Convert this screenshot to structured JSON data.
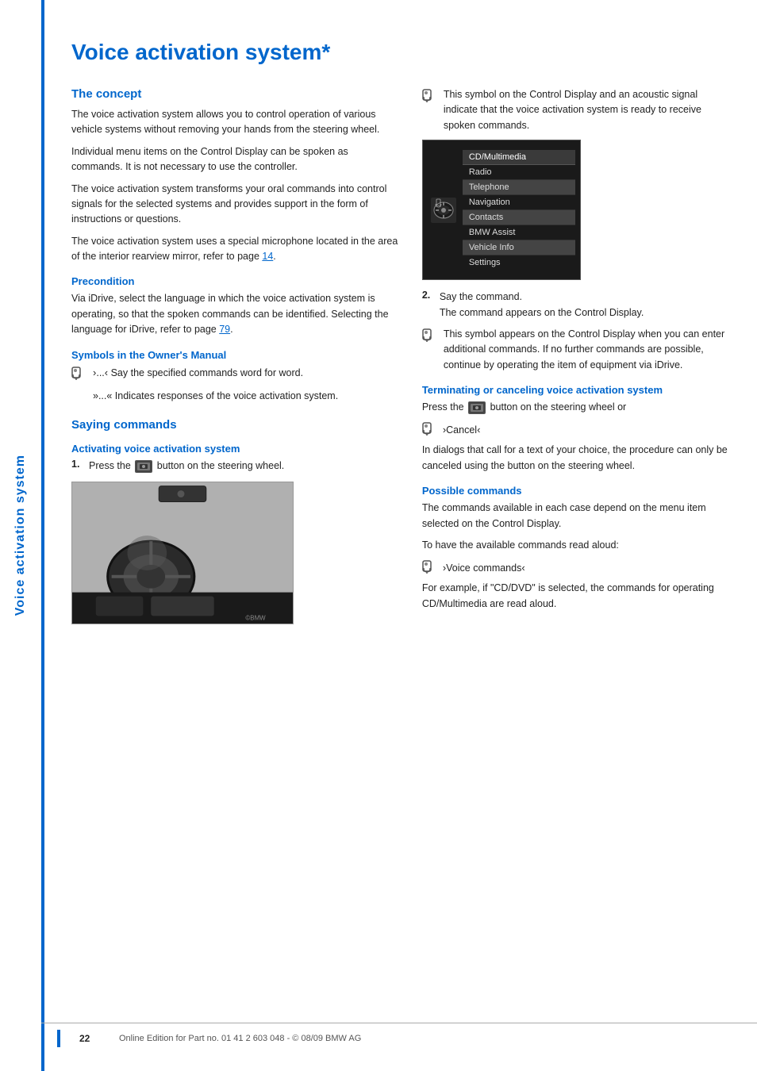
{
  "sidebar": {
    "label": "Voice activation system"
  },
  "page": {
    "title": "Voice activation system*",
    "sections": {
      "concept": {
        "heading": "The concept",
        "paragraphs": [
          "The voice activation system allows you to control operation of various vehicle systems without removing your hands from the steering wheel.",
          "Individual menu items on the Control Display can be spoken as commands. It is not necessary to use the controller.",
          "The voice activation system transforms your oral commands into control signals for the selected systems and provides support in the form of instructions or questions.",
          "The voice activation system uses a special microphone located in the area of the interior rearview mirror, refer to page 14."
        ]
      },
      "precondition": {
        "heading": "Precondition",
        "text": "Via iDrive, select the language in which the voice activation system is operating, so that the spoken commands can be identified. Selecting the language for iDrive, refer to page 79."
      },
      "symbols": {
        "heading": "Symbols in the Owner's Manual",
        "line1": "›...‹ Say the specified commands word for word.",
        "line2": "»...« Indicates responses of the voice activation system."
      },
      "saying_commands": {
        "heading": "Saying commands",
        "activating": {
          "sub_heading": "Activating voice activation system",
          "step1": "Press the",
          "step1_suffix": "button on the steering wheel.",
          "step2_label": "2.",
          "step2_text": "Say the command.",
          "step2_detail": "The command appears on the Control Display."
        }
      },
      "right_col": {
        "symbol_note": "This symbol on the Control Display and an acoustic signal indicate that the voice activation system is ready to receive spoken commands.",
        "symbol_note2": "This symbol appears on the Control Display when you can enter additional commands. If no further commands are possible, continue by operating the item of equipment via iDrive.",
        "terminating": {
          "heading": "Terminating or canceling voice activation system",
          "text1": "Press the",
          "text1_suffix": "button on the steering wheel or",
          "cancel_cmd": "›Cancel‹",
          "text2": "In dialogs that call for a text of your choice, the procedure can only be canceled using the button on the steering wheel."
        },
        "possible_commands": {
          "heading": "Possible commands",
          "text1": "The commands available in each case depend on the menu item selected on the Control Display.",
          "text2": "To have the available commands read aloud:",
          "voice_cmd": "›Voice commands‹",
          "text3": "For example, if \"CD/DVD\" is selected, the commands for operating CD/Multimedia are read aloud."
        }
      }
    },
    "menu_items": [
      "CD/Multimedia",
      "Radio",
      "Telephone",
      "Navigation",
      "Contacts",
      "BMW Assist",
      "Vehicle Info",
      "Settings"
    ],
    "footer": {
      "page_number": "22",
      "text": "Online Edition for Part no. 01 41 2 603 048 - © 08/09 BMW AG"
    }
  }
}
